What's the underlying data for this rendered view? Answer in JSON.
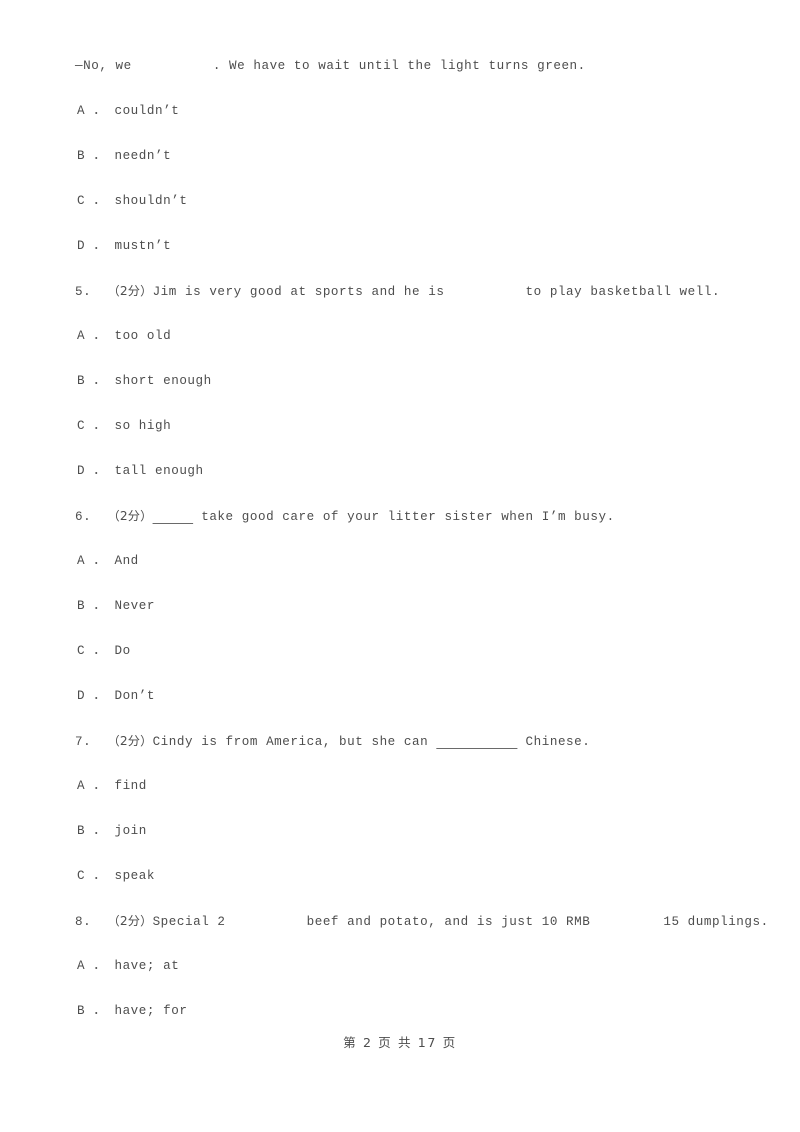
{
  "document": {
    "type": "exam-worksheet",
    "language": "en-with-zh-annotations",
    "background_color": "#ffffff",
    "text_color": "#4d4d4d"
  },
  "carryover_question": {
    "stem": "—No, we          . We have to wait until the light turns green.",
    "options": [
      "A ． couldn’t",
      "B ． needn’t",
      "C ． shouldn’t",
      "D ． mustn’t"
    ]
  },
  "questions": [
    {
      "number": "5.",
      "marks": "（2分）",
      "stem_before": "Jim is very good at sports and he is",
      "blank": "          ",
      "blank_style": "gap",
      "stem_after": "to play basketball well.",
      "options": [
        "A ． too old",
        "B ． short enough",
        "C ． so high",
        "D ． tall enough"
      ]
    },
    {
      "number": "6.",
      "marks": "（2分）",
      "stem_before": "",
      "blank": "_____",
      "blank_style": "rule",
      "stem_after": " take good care of your litter sister when I’m busy.",
      "options": [
        "A ． And",
        "B ． Never",
        "C ． Do",
        "D ． Don’t"
      ]
    },
    {
      "number": "7.",
      "marks": "（2分）",
      "stem_before": "Cindy is from America, but she can ",
      "blank": "__________",
      "blank_style": "rule",
      "stem_after": " Chinese.",
      "options": [
        "A ． find",
        "B ． join",
        "C ． speak"
      ]
    },
    {
      "number": "8.",
      "marks": "（2分）",
      "stem_before": "Special 2",
      "blank": "          ",
      "blank_style": "gap",
      "stem_middle": "beef and potato, and is just 10 RMB",
      "blank2": "         ",
      "stem_after": "15 dumplings.",
      "options": [
        "A ． have; at",
        "B ． have; for"
      ]
    }
  ],
  "footer": {
    "text": "第 2 页 共 17 页"
  }
}
